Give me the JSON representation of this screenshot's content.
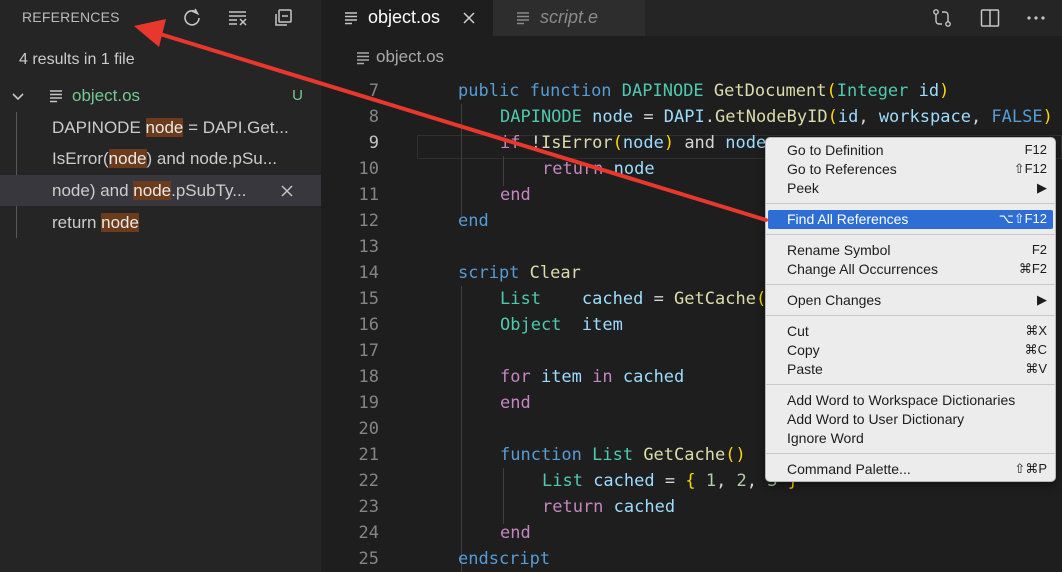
{
  "sidebar": {
    "title": "REFERENCES",
    "summary": "4 results in 1 file",
    "file": {
      "name": "object.os",
      "status": "U"
    },
    "refs": [
      {
        "pre": "DAPINODE ",
        "match": "node",
        "post": " = DAPI.Get..."
      },
      {
        "pre": "IsError(",
        "match": "node",
        "post": ") and node.pSu..."
      },
      {
        "pre": "node) and ",
        "match": "node",
        "post": ".pSubTy..."
      },
      {
        "pre": "return ",
        "match": "node",
        "post": ""
      }
    ]
  },
  "tabs": [
    {
      "label": "object.os"
    },
    {
      "label": "script.e"
    }
  ],
  "breadcrumb": {
    "file": "object.os"
  },
  "editor": {
    "line_numbers": [
      "7",
      "8",
      "9",
      "10",
      "11",
      "12",
      "13",
      "14",
      "15",
      "16",
      "17",
      "18",
      "19",
      "20",
      "21",
      "22",
      "23",
      "24",
      "25"
    ]
  },
  "context_menu": {
    "items": [
      {
        "label": "Go to Definition",
        "shortcut": "F12"
      },
      {
        "label": "Go to References",
        "shortcut": "⇧F12"
      },
      {
        "label": "Peek",
        "shortcut": "▶"
      },
      {
        "label": "Find All References",
        "shortcut": "⌥⇧F12"
      },
      {
        "label": "Rename Symbol",
        "shortcut": "F2"
      },
      {
        "label": "Change All Occurrences",
        "shortcut": "⌘F2"
      },
      {
        "label": "Open Changes",
        "shortcut": "▶"
      },
      {
        "label": "Cut",
        "shortcut": "⌘X"
      },
      {
        "label": "Copy",
        "shortcut": "⌘C"
      },
      {
        "label": "Paste",
        "shortcut": "⌘V"
      },
      {
        "label": "Add Word to Workspace Dictionaries",
        "shortcut": ""
      },
      {
        "label": "Add Word to User Dictionary",
        "shortcut": ""
      },
      {
        "label": "Ignore Word",
        "shortcut": ""
      },
      {
        "label": "Command Palette...",
        "shortcut": "⇧⌘P"
      }
    ]
  },
  "colors": {
    "annotation_arrow": "#e8372c",
    "menu_highlight": "#2e6dd4",
    "untracked_file": "#73c991",
    "reference_match": "#6b3b1c"
  },
  "icons": {
    "refresh": "refresh-icon",
    "clear": "clear-all-icon",
    "collapse": "collapse-all-icon",
    "compare": "compare-changes-icon",
    "split": "split-editor-icon",
    "more": "more-actions-icon"
  }
}
